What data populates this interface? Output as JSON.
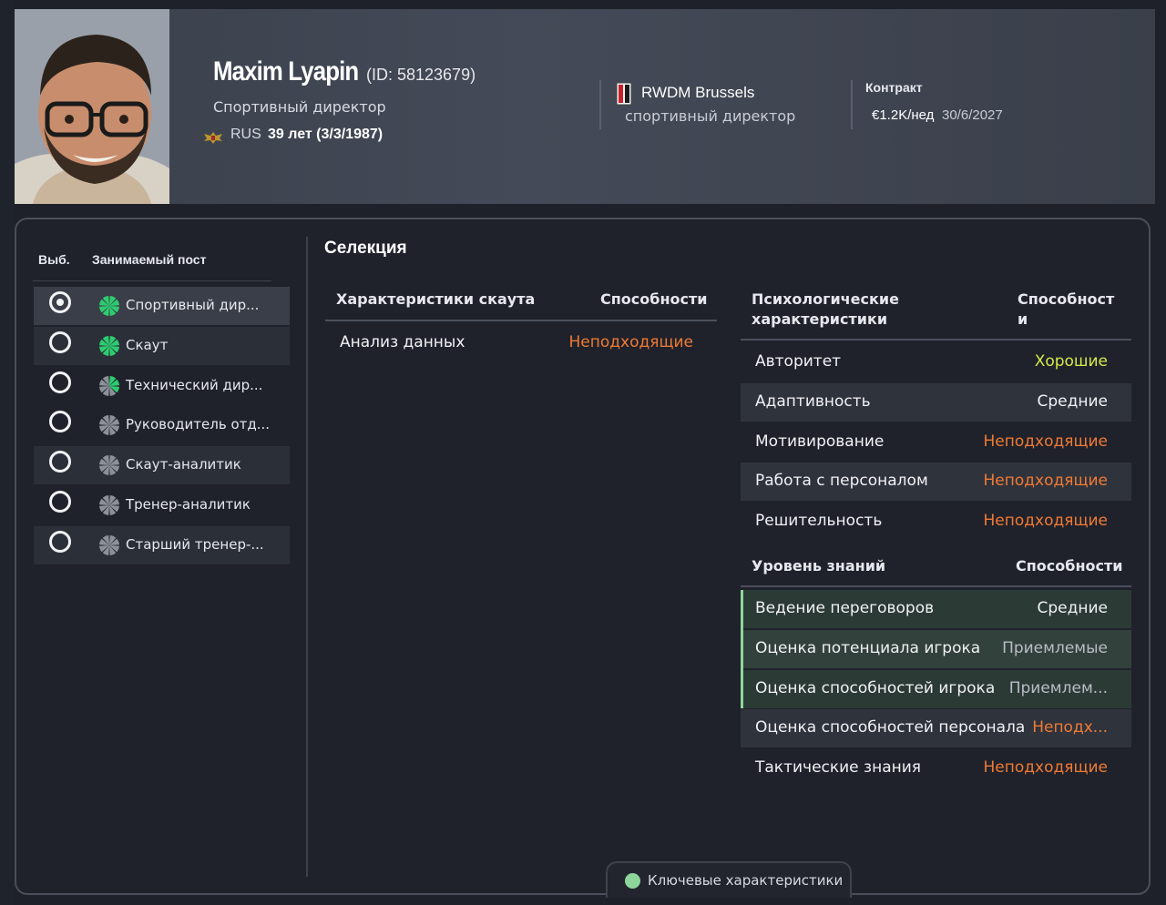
{
  "colors": {
    "unsuitable": "#f07a35",
    "good": "#d6e94a",
    "average": "#f0f1f4",
    "acceptable": "#b9bcc4",
    "key_indicator": "#8ed59a",
    "role_icon_green": "#2ecc71",
    "role_icon_grey": "#8c9099"
  },
  "person": {
    "name": "Maxim Lyapin",
    "id_text": "(ID: 58123679)",
    "role": "Спортивный директор",
    "nationality": "RUS",
    "flag_icon": "russia-coat-of-arms-icon",
    "age_dob": "39 лет (3/3/1987)"
  },
  "club": {
    "icon": "rwdm-club-badge-icon",
    "name": "RWDM Brussels",
    "role": "спортивный директор"
  },
  "contract": {
    "label": "Контракт",
    "wage": "€1.2K/нед",
    "expiry": "30/6/2027"
  },
  "roles_panel": {
    "col_select": "Выб.",
    "col_position": "Занимаемый пост",
    "items": [
      {
        "label": "Спортивный дир...",
        "selected": true,
        "icon_level": 8
      },
      {
        "label": "Скаут",
        "selected": false,
        "icon_level": 8
      },
      {
        "label": "Технический дир...",
        "selected": false,
        "icon_level": 3
      },
      {
        "label": "Руководитель отд...",
        "selected": false,
        "icon_level": 0
      },
      {
        "label": "Скаут-аналитик",
        "selected": false,
        "icon_level": 0
      },
      {
        "label": "Тренер-аналитик",
        "selected": false,
        "icon_level": 0
      },
      {
        "label": "Старший тренер-...",
        "selected": false,
        "icon_level": 0
      }
    ]
  },
  "selection": {
    "title": "Селекция",
    "scout_table": {
      "col_attr": "Характеристики скаута",
      "col_ability": "Способности",
      "rows": [
        {
          "name": "Анализ данных",
          "value": "Неподходящие",
          "tone": "unsuitable"
        }
      ]
    },
    "mental_table": {
      "col_attr": "Психологические характеристики",
      "col_ability": "Способности",
      "rows": [
        {
          "name": "Авторитет",
          "value": "Хорошие",
          "tone": "good"
        },
        {
          "name": "Адаптивность",
          "value": "Средние",
          "tone": "average"
        },
        {
          "name": "Мотивирование",
          "value": "Неподходящие",
          "tone": "unsuitable"
        },
        {
          "name": "Работа с персоналом",
          "value": "Неподходящие",
          "tone": "unsuitable"
        },
        {
          "name": "Решительность",
          "value": "Неподходящие",
          "tone": "unsuitable"
        }
      ]
    },
    "knowledge_table": {
      "col_attr": "Уровень знаний",
      "col_ability": "Способности",
      "rows": [
        {
          "name": "Ведение переговоров",
          "value": "Средние",
          "tone": "average",
          "key": true
        },
        {
          "name": "Оценка потенциала игрока",
          "value": "Приемлемые",
          "tone": "acceptable",
          "key": true
        },
        {
          "name": "Оценка способностей игрока",
          "value": "Приемлем...",
          "tone": "acceptable",
          "key": true
        },
        {
          "name": "Оценка способностей персонала",
          "value": "Неподх...",
          "tone": "unsuitable",
          "key": false
        },
        {
          "name": "Тактические знания",
          "value": "Неподходящие",
          "tone": "unsuitable",
          "key": false
        }
      ]
    }
  },
  "legend": {
    "label": "Ключевые характеристики",
    "icon": "key-attribute-dot-icon"
  }
}
